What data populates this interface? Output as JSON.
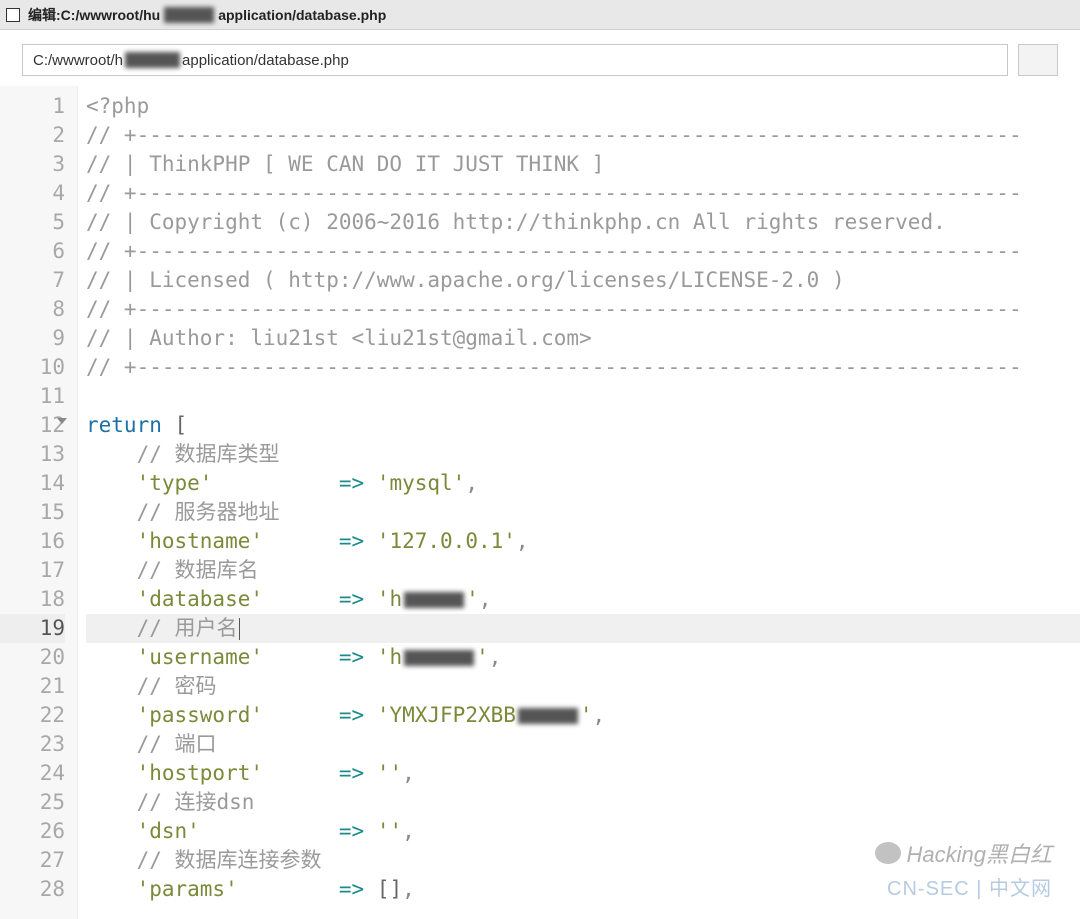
{
  "titlebar": {
    "label_prefix": "编辑: ",
    "path_visible_a": "C:/wwwroot/hu",
    "path_visible_b": "application/database.php"
  },
  "pathbar": {
    "value_a": "C:/wwwroot/h",
    "value_b": "application/database.php"
  },
  "watermarks": {
    "wm1": "Hacking黑白红",
    "wm2": "CN-SEC | 中文网"
  },
  "code": {
    "active_line": 19,
    "lines": [
      {
        "n": 1,
        "tokens": [
          {
            "t": "<?php",
            "c": "cm"
          }
        ]
      },
      {
        "n": 2,
        "tokens": [
          {
            "t": "// +----------------------------------------------------------------------",
            "c": "cm"
          }
        ]
      },
      {
        "n": 3,
        "tokens": [
          {
            "t": "// | ThinkPHP [ WE CAN DO IT JUST THINK ]",
            "c": "cm"
          }
        ]
      },
      {
        "n": 4,
        "tokens": [
          {
            "t": "// +----------------------------------------------------------------------",
            "c": "cm"
          }
        ]
      },
      {
        "n": 5,
        "tokens": [
          {
            "t": "// | Copyright (c) 2006~2016 http://thinkphp.cn All rights reserved.",
            "c": "cm"
          }
        ]
      },
      {
        "n": 6,
        "tokens": [
          {
            "t": "// +----------------------------------------------------------------------",
            "c": "cm"
          }
        ]
      },
      {
        "n": 7,
        "tokens": [
          {
            "t": "// | Licensed ( http://www.apache.org/licenses/LICENSE-2.0 )",
            "c": "cm"
          }
        ]
      },
      {
        "n": 8,
        "tokens": [
          {
            "t": "// +----------------------------------------------------------------------",
            "c": "cm"
          }
        ]
      },
      {
        "n": 9,
        "tokens": [
          {
            "t": "// | Author: liu21st <liu21st@gmail.com>",
            "c": "cm"
          }
        ]
      },
      {
        "n": 10,
        "tokens": [
          {
            "t": "// +----------------------------------------------------------------------",
            "c": "cm"
          }
        ]
      },
      {
        "n": 11,
        "tokens": [
          {
            "t": "",
            "c": ""
          }
        ]
      },
      {
        "n": 12,
        "fold": true,
        "tokens": [
          {
            "t": "return",
            "c": "kw"
          },
          {
            "t": " [",
            "c": "br"
          }
        ]
      },
      {
        "n": 13,
        "indent": 1,
        "tokens": [
          {
            "t": "// 数据库类型",
            "c": "cm"
          }
        ]
      },
      {
        "n": 14,
        "indent": 1,
        "tokens": [
          {
            "t": "'type'",
            "c": "str",
            "pad": 14
          },
          {
            "t": " => ",
            "c": "op"
          },
          {
            "t": "'mysql'",
            "c": "str"
          },
          {
            "t": ",",
            "c": "pu"
          }
        ]
      },
      {
        "n": 15,
        "indent": 1,
        "tokens": [
          {
            "t": "// 服务器地址",
            "c": "cm"
          }
        ]
      },
      {
        "n": 16,
        "indent": 1,
        "tokens": [
          {
            "t": "'hostname'",
            "c": "str",
            "pad": 14
          },
          {
            "t": " => ",
            "c": "op"
          },
          {
            "t": "'127.0.0.1'",
            "c": "str"
          },
          {
            "t": ",",
            "c": "pu"
          }
        ]
      },
      {
        "n": 17,
        "indent": 1,
        "tokens": [
          {
            "t": "// 数据库名",
            "c": "cm"
          }
        ]
      },
      {
        "n": 18,
        "indent": 1,
        "tokens": [
          {
            "t": "'database'",
            "c": "str",
            "pad": 14
          },
          {
            "t": " => ",
            "c": "op"
          },
          {
            "t": "'h",
            "c": "str"
          },
          {
            "censor": 60
          },
          {
            "t": "'",
            "c": "str"
          },
          {
            "t": ",",
            "c": "pu"
          }
        ]
      },
      {
        "n": 19,
        "indent": 1,
        "tokens": [
          {
            "t": "// 用户名",
            "c": "cm"
          },
          {
            "cursor": true
          }
        ]
      },
      {
        "n": 20,
        "indent": 1,
        "tokens": [
          {
            "t": "'username'",
            "c": "str",
            "pad": 14
          },
          {
            "t": " => ",
            "c": "op"
          },
          {
            "t": "'h",
            "c": "str"
          },
          {
            "censor": 70
          },
          {
            "t": "'",
            "c": "str"
          },
          {
            "t": ",",
            "c": "pu"
          }
        ]
      },
      {
        "n": 21,
        "indent": 1,
        "tokens": [
          {
            "t": "// 密码",
            "c": "cm"
          }
        ]
      },
      {
        "n": 22,
        "indent": 1,
        "tokens": [
          {
            "t": "'password'",
            "c": "str",
            "pad": 14
          },
          {
            "t": " => ",
            "c": "op"
          },
          {
            "t": "'YMXJFP2XBB",
            "c": "str"
          },
          {
            "censor": 60
          },
          {
            "t": "'",
            "c": "str"
          },
          {
            "t": ",",
            "c": "pu"
          }
        ]
      },
      {
        "n": 23,
        "indent": 1,
        "tokens": [
          {
            "t": "// 端口",
            "c": "cm"
          }
        ]
      },
      {
        "n": 24,
        "indent": 1,
        "tokens": [
          {
            "t": "'hostport'",
            "c": "str",
            "pad": 14
          },
          {
            "t": " => ",
            "c": "op"
          },
          {
            "t": "''",
            "c": "str"
          },
          {
            "t": ",",
            "c": "pu"
          }
        ]
      },
      {
        "n": 25,
        "indent": 1,
        "tokens": [
          {
            "t": "// 连接dsn",
            "c": "cm"
          }
        ]
      },
      {
        "n": 26,
        "indent": 1,
        "tokens": [
          {
            "t": "'dsn'",
            "c": "str",
            "pad": 14
          },
          {
            "t": " => ",
            "c": "op"
          },
          {
            "t": "''",
            "c": "str"
          },
          {
            "t": ",",
            "c": "pu"
          }
        ]
      },
      {
        "n": 27,
        "indent": 1,
        "tokens": [
          {
            "t": "// 数据库连接参数",
            "c": "cm"
          }
        ]
      },
      {
        "n": 28,
        "indent": 1,
        "tokens": [
          {
            "t": "'params'",
            "c": "str",
            "pad": 14
          },
          {
            "t": " => ",
            "c": "op"
          },
          {
            "t": "[]",
            "c": "br"
          },
          {
            "t": ",",
            "c": "pu"
          }
        ]
      }
    ]
  }
}
